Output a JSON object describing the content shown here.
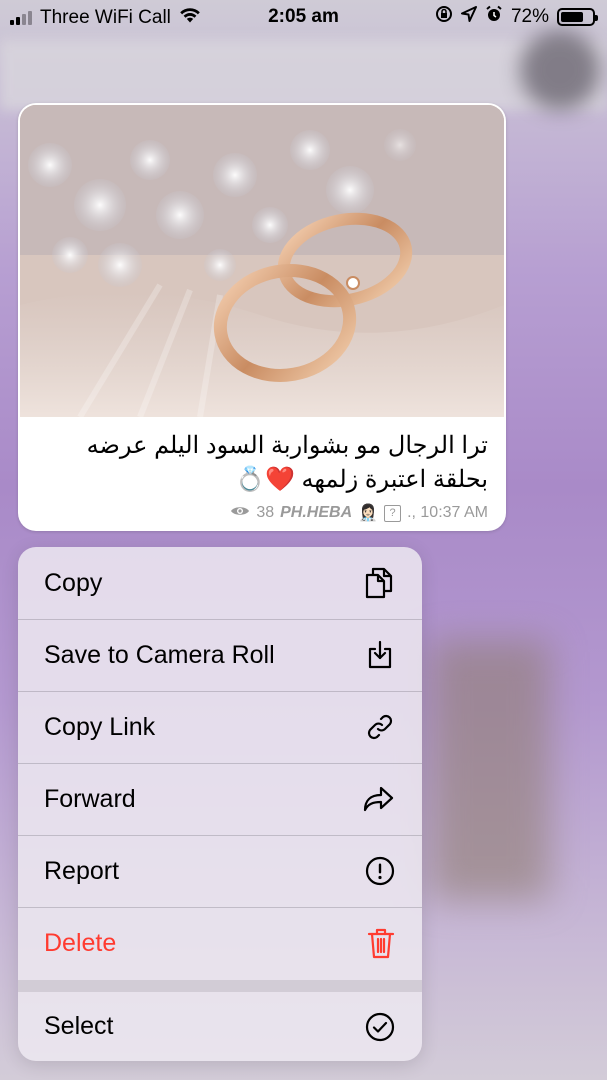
{
  "status_bar": {
    "carrier": "Three WiFi Call",
    "time": "2:05 am",
    "battery_percent": "72%",
    "battery_level": 0.72
  },
  "message": {
    "caption_line1": "ترا الرجال مو بشواربة السود اليلم عرضه",
    "caption_line2": "بحلقة اعتبرة زلمهه ❤️💍",
    "views": "38",
    "signature": "PH.HEBA",
    "signature_emoji": "👩🏻‍⚕️",
    "unknown_glyph": "?",
    "time": "., 10:37 AM",
    "image_subject": "wedding-rings-photo"
  },
  "context_menu": {
    "items": [
      {
        "label": "Copy",
        "icon": "copy-icon"
      },
      {
        "label": "Save to Camera Roll",
        "icon": "save-download-icon"
      },
      {
        "label": "Copy Link",
        "icon": "link-icon"
      },
      {
        "label": "Forward",
        "icon": "forward-arrow-icon"
      },
      {
        "label": "Report",
        "icon": "exclamation-circle-icon"
      },
      {
        "label": "Delete",
        "icon": "trash-icon"
      },
      {
        "label": "Select",
        "icon": "checkmark-circle-icon"
      }
    ]
  },
  "colors": {
    "destructive": "#ff3b30",
    "menu_background": "#ece8f0",
    "chat_background": "#a98ac8"
  }
}
